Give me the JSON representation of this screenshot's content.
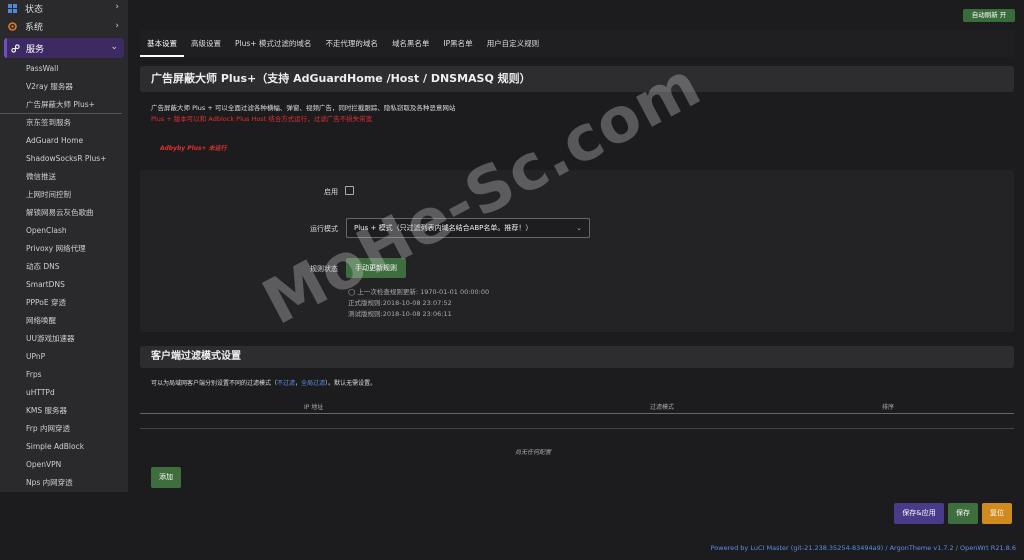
{
  "sidebar": {
    "status": "状态",
    "system": "系统",
    "services": "服务",
    "items": [
      "PassWall",
      "V2ray 服务器",
      "广告屏蔽大师 Plus+",
      "京东签到服务",
      "AdGuard Home",
      "ShadowSocksR Plus+",
      "微信推送",
      "上网时间控制",
      "解锁网易云灰色歌曲",
      "OpenClash",
      "Privoxy 网络代理",
      "动态 DNS",
      "SmartDNS",
      "PPPoE 穿透",
      "网络唤醒",
      "UU游戏加速器",
      "UPnP",
      "Frps",
      "uHTTPd",
      "KMS 服务器",
      "Frp 内网穿透",
      "Simple AdBlock",
      "OpenVPN",
      "Nps 内网穿透"
    ]
  },
  "autorefresh": "自动刷新 开",
  "tabs": [
    "基本设置",
    "高级设置",
    "Plus+ 模式过滤的域名",
    "不走代理的域名",
    "域名黑名单",
    "IP黑名单",
    "用户自定义规则"
  ],
  "page": {
    "title": "广告屏蔽大师 Plus+（支持 AdGuardHome /Host / DNSMASQ 规则）",
    "desc": "广告屏蔽大师 Plus + 可以全面过滤各种横幅、弹窗、视频广告，同时拦截跟踪、隐私窃取及各种恶意网站",
    "warn": "Plus + 版本可以和 Adblock Plus Host 结合方式运行，过滤广告不损失带宽",
    "status": "Adbyby Plus+ 未运行"
  },
  "form": {
    "enable_label": "启用",
    "mode_label": "运行模式",
    "mode_value": "Plus + 模式（只过滤列表内域名结合ABP名单。推荐！）",
    "rule_label": "规则状态",
    "update_button": "手动更新规则",
    "last_check": "上一次检查规则更新: 1970-01-01 00:00:00",
    "official_rule": "正式版规则:2018-10-08 23:07:52",
    "test_rule": "测试版规则:2018-10-08 23:06:11"
  },
  "client": {
    "title": "客户端过滤模式设置",
    "desc_prefix": "可以为局域网客户端分别设置不同的过滤模式（",
    "link1": "不过滤",
    "sep": "，",
    "link2": "全局过滤",
    "desc_suffix": "）。默认无需设置。",
    "col_ip": "IP 地址",
    "col_mode": "过滤模式",
    "col_sort": "排序",
    "empty": "尚无任何配置",
    "add": "添加"
  },
  "footer": {
    "save_apply": "保存&应用",
    "save": "保存",
    "reset": "复位",
    "powered": "Powered by LuCI Master (git-21.238.35254-83494a9) / ArgonTheme v1.7.2 / OpenWrt R21.8.6"
  },
  "watermark": "MoHe-Sc.com"
}
